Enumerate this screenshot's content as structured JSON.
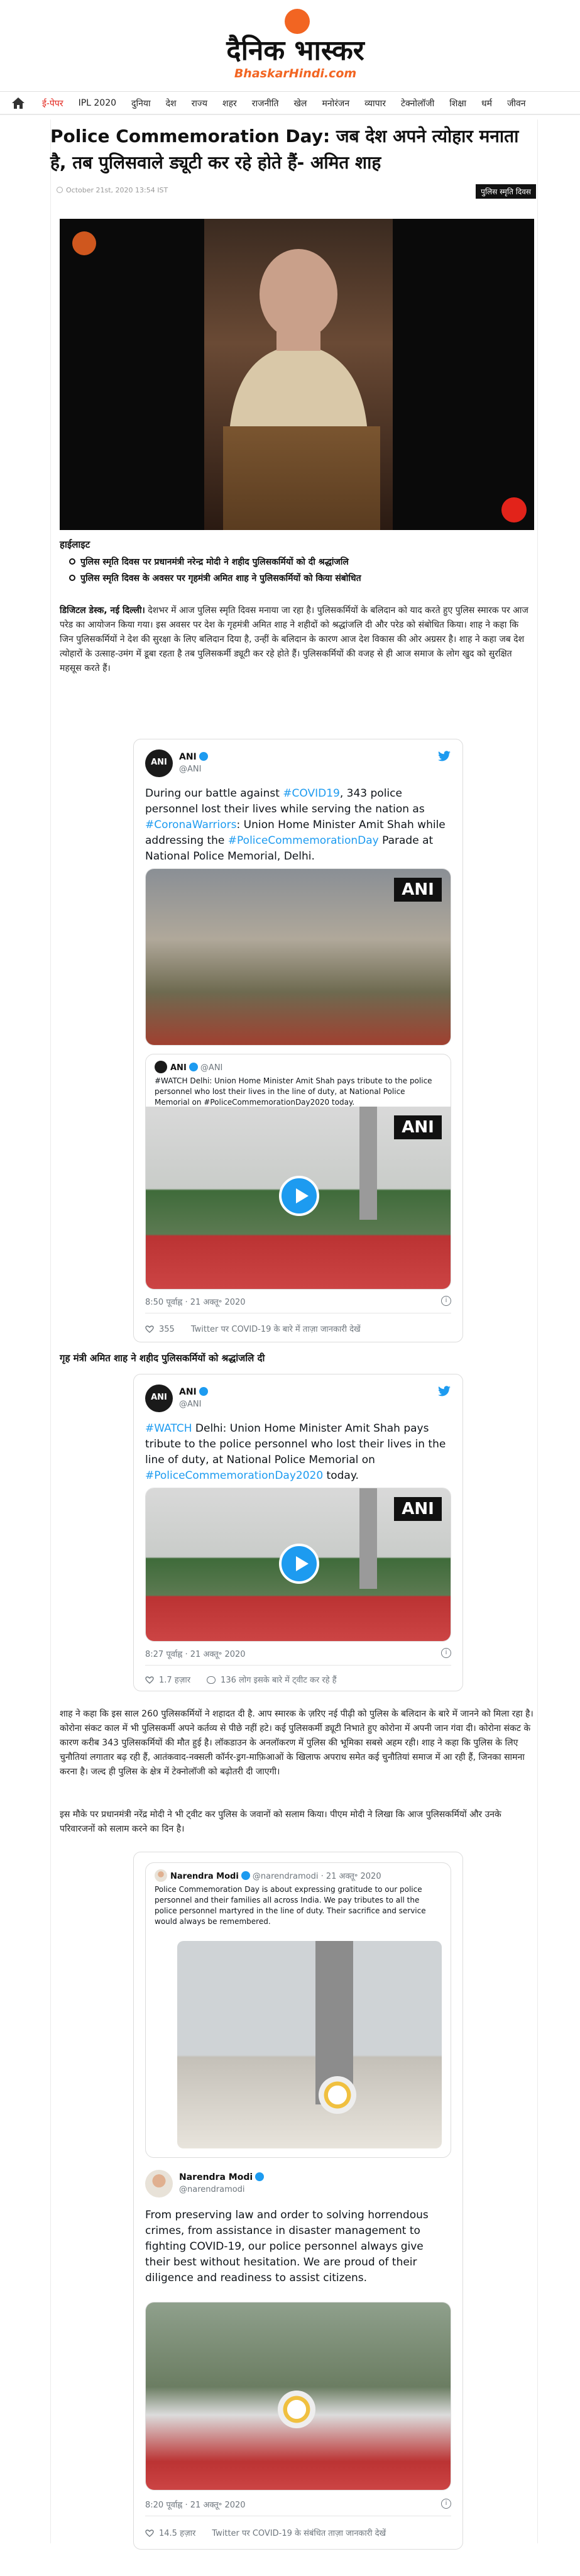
{
  "site": {
    "logo_hindi": "दैनिक भास्कर",
    "logo_english": "BhaskarHindi.com",
    "brand_color": "#f26522"
  },
  "nav": {
    "home_icon": "home-icon",
    "items": [
      "ई-पेपर",
      "IPL 2020",
      "दुनिया",
      "देश",
      "राज्य",
      "शहर",
      "राजनीति",
      "खेल",
      "मनोरंजन",
      "व्यापार",
      "टेक्नोलॉजी",
      "शिक्षा",
      "धर्म",
      "जीवन"
    ]
  },
  "article": {
    "headline": "Police Commemoration Day: जब देश अपने त्योहार मनाता है, तब पुलिसवाले ड्यूटी कर रहे होते हैं- अमित शाह",
    "date": "October 21st, 2020 13:54 IST",
    "tag": "पुलिस स्मृति दिवस",
    "highlights_title": "हाईलाइट",
    "highlights": [
      "पुलिस स्मृति दिवस पर प्रधानमंत्री नरेन्द्र मोदी ने शहीद पुलिसकर्मियों को दी श्रद्धांजलि",
      "पुलिस स्मृति दिवस के अवसर पर गृहमंत्री अमित शाह ने पुलिसकर्मियों को किया संबोधित"
    ],
    "intro_bold": "डिजिटल डेस्क, नई दिल्ली।",
    "intro_text": " देशभर में आज पुलिस स्मृति दिवस मनाया जा रहा है। पुलिसकर्मियों के बलिदान को याद करते हुए पुलिस स्मारक पर आज परेड का आयोजन किया गया। इस अवसर पर देश के गृहमंत्री अमित शाह ने शहीदों को श्रद्धांजलि दी और परेड को संबोधित किया। शाह ने कहा कि जिन पुलिसकर्मियों ने देश की सुरक्षा के लिए बलिदान दिया है, उन्हीं के बलिदान के कारण आज देश विकास की ओर अग्रसर है। शाह ने कहा जब देश त्योहारों के उत्साह-उमंग में डूबा रहता है तब पुलिसकर्मी ड्यूटी कर रहे होते हैं। पुलिसकर्मियों की वजह से ही आज समाज के लोग खुद को सुरक्षित महसूस करते हैं।",
    "subhead": "गृह मंत्री अमित शाह ने शहीद पुलिसकर्मियों को श्रद्धांजलि दी",
    "para2": "शाह ने कहा कि इस साल 260 पुलिसकर्मियों ने शहादत दी है. आप स्मारक के ज़रिए नई पीढ़ी को पुलिस के बलिदान के बारे में जानने को मिला रहा है।  कोरोना संकट काल में भी पुलिसकर्मी अपने कर्तव्य से पीछे नहीं हटे। कई पुलिसकर्मी ड्यूटी निभाते हुए कोरोना में अपनी जान गंवा दी। कोरोना संकट के कारण करीब 343 पुलिसकर्मियों की मौत हुई है। लॉकडाउन के अनलॉकरण में पुलिस की भूमिका सबसे अहम रही। शाह ने कहा कि  पुलिस के लिए चुनौतियां लगातार बढ़ रही हैं, आतंकवाद-नक्सली कॉर्नर-ड्रग-माफ़िआओं के खिलाफ अपराध समेत कई चुनौतियां समाज में आ रही हैं, जिनका सामना करना है। जल्द ही पुलिस के क्षेत्र में टेक्नोलॉजी को बढ़ोतरी दी जाएगी।",
    "para3": "इस मौके पर प्रधानमंत्री नरेंद्र मोदी ने भी ट्वीट कर पुलिस के जवानों को सलाम किया। पीएम मोदी ने लिखा कि आज पुलिसकर्मियों और उनके परिवारजनों को सलाम करने का दिन है।"
  },
  "tweets": [
    {
      "name": "ANI",
      "handle": "@ANI",
      "avatar_text": "ANI",
      "text_plain_1": "During our battle against ",
      "tag_1": "#COVID19",
      "text_plain_2": ", 343 police personnel lost their lives while serving the nation as ",
      "tag_2": "#CoronaWarriors",
      "text_plain_3": ": Union Home Minister Amit Shah while addressing the ",
      "tag_3": "#PoliceCommemorationDay",
      "text_plain_4": " Parade at National Police Memorial, Delhi.",
      "image_badge": "ANI",
      "quote_name": "ANI",
      "quote_handle": "@ANI",
      "quote_text": "#WATCH Delhi: Union Home Minister Amit Shah pays tribute to the police personnel who lost their lives in the line of duty, at National Police Memorial on #PoliceCommemorationDay2020 today.",
      "quote_badge": "ANI",
      "time": "8:50 पूर्वाह्न · 21 अक्तू॰ 2020",
      "likes": "355",
      "footer_link": "Twitter पर COVID-19 के बारे में ताज़ा जानकारी देखें"
    },
    {
      "name": "ANI",
      "handle": "@ANI",
      "avatar_text": "ANI",
      "tag_1": "#WATCH",
      "text_plain_1": " Delhi: Union Home Minister Amit Shah pays tribute to the police personnel who lost their lives in the line of duty, at National Police Memorial on ",
      "tag_2": "#PoliceCommemorationDay2020",
      "text_plain_2": " today.",
      "image_badge": "ANI",
      "time": "8:27 पूर्वाह्न · 21 अक्तू॰ 2020",
      "likes": "1.7 हज़ार",
      "footer_link": "136 लोग इसके बारे में ट्वीट कर रहे हैं"
    },
    {
      "name": "Narendra Modi",
      "handle": "@narendramodi",
      "quote_name": "Narendra Modi",
      "quote_handle": "@narendramodi · 21 अक्तू॰ 2020",
      "quote_text": "Police Commemoration Day is about expressing gratitude to our police personnel and their families all across India. We pay tributes to all the police personnel martyred in the line of duty. Their sacrifice and service would always be remembered.",
      "text": "From preserving law and order to solving horrendous crimes, from assistance in disaster management to fighting COVID-19, our police personnel always give their best without hesitation. We are proud of their diligence and readiness to assist citizens.",
      "time": "8:20 पूर्वाह्न · 21 अक्तू॰ 2020",
      "likes": "14.5 हज़ार",
      "footer_link": "Twitter पर COVID-19 के संबंधित ताज़ा जानकारी देखें"
    }
  ],
  "colors": {
    "twitter_blue": "#1d9bf0",
    "nav_red": "#e2231a"
  }
}
